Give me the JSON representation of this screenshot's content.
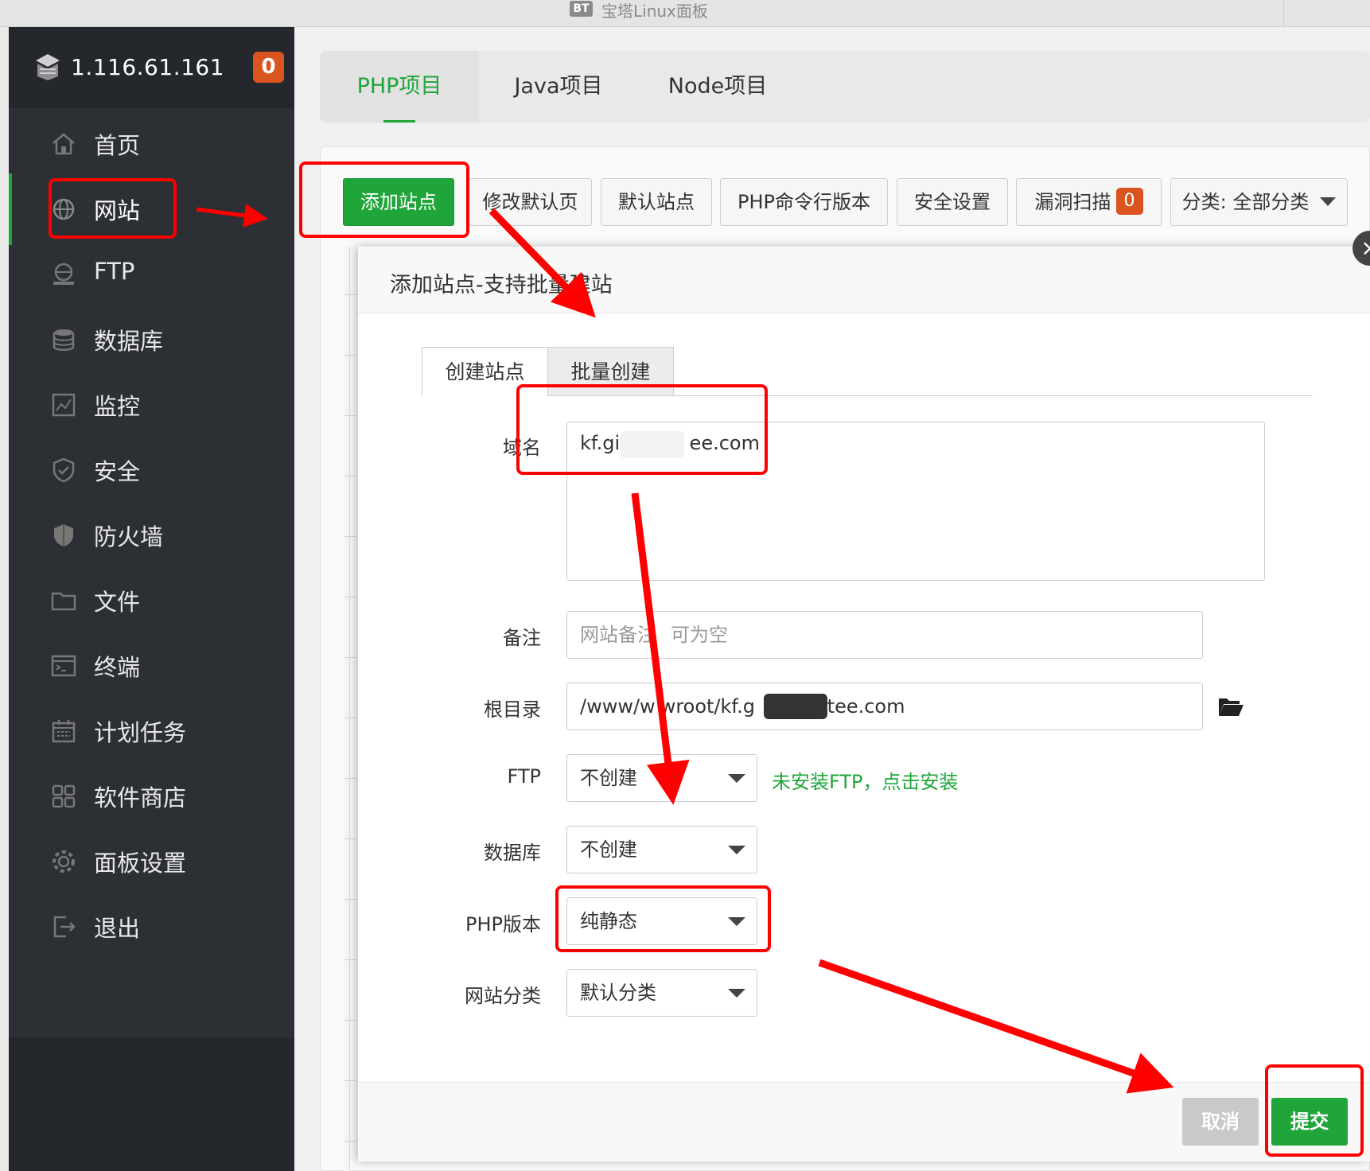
{
  "window": {
    "title": "宝塔Linux面板",
    "badge": "BT"
  },
  "sidebar": {
    "server_ip": "1.116.61.161",
    "message_count": "0",
    "items": [
      {
        "label": "首页",
        "icon": "home-icon"
      },
      {
        "label": "网站",
        "icon": "globe-icon",
        "active": true
      },
      {
        "label": "FTP",
        "icon": "ftp-icon"
      },
      {
        "label": "数据库",
        "icon": "database-icon"
      },
      {
        "label": "监控",
        "icon": "monitor-icon"
      },
      {
        "label": "安全",
        "icon": "shield-icon"
      },
      {
        "label": "防火墙",
        "icon": "firewall-icon"
      },
      {
        "label": "文件",
        "icon": "folder-icon"
      },
      {
        "label": "终端",
        "icon": "terminal-icon"
      },
      {
        "label": "计划任务",
        "icon": "calendar-icon"
      },
      {
        "label": "软件商店",
        "icon": "apps-icon"
      },
      {
        "label": "面板设置",
        "icon": "gear-icon"
      },
      {
        "label": "退出",
        "icon": "logout-icon"
      }
    ]
  },
  "project_tabs": [
    {
      "label": "PHP项目",
      "active": true
    },
    {
      "label": "Java项目"
    },
    {
      "label": "Node项目"
    }
  ],
  "toolbar": {
    "add_site": "添加站点",
    "edit_default_page": "修改默认页",
    "default_site": "默认站点",
    "php_cli_version": "PHP命令行版本",
    "security_settings": "安全设置",
    "vuln_scan": "漏洞扫描",
    "vuln_count": "0",
    "category": "分类: 全部分类"
  },
  "modal": {
    "title": "添加站点-支持批量建站",
    "tabs": [
      "创建站点",
      "批量创建"
    ],
    "fields": {
      "domain_label": "域名",
      "domain_value_start": "kf.git",
      "domain_value_end": "ee.com",
      "remark_label": "备注",
      "remark_placeholder_start": "网站备注",
      "remark_placeholder_end": "可为空",
      "root_label": "根目录",
      "root_value_start": "/www/w",
      "root_value_mid": "wroot/kf.g",
      "root_value_end": "itee.com",
      "ftp_label": "FTP",
      "ftp_value": "不创建",
      "ftp_hint": "未安装FTP，点击安装",
      "db_label": "数据库",
      "db_value": "不创建",
      "php_label": "PHP版本",
      "php_value": "纯静态",
      "category_label": "网站分类",
      "category_value": "默认分类"
    },
    "cancel": "取消",
    "submit": "提交"
  },
  "colors": {
    "accent": "#20a53a",
    "badge": "#d9541e",
    "annotation": "#ff0000",
    "sidebar": "#2c2f34"
  }
}
